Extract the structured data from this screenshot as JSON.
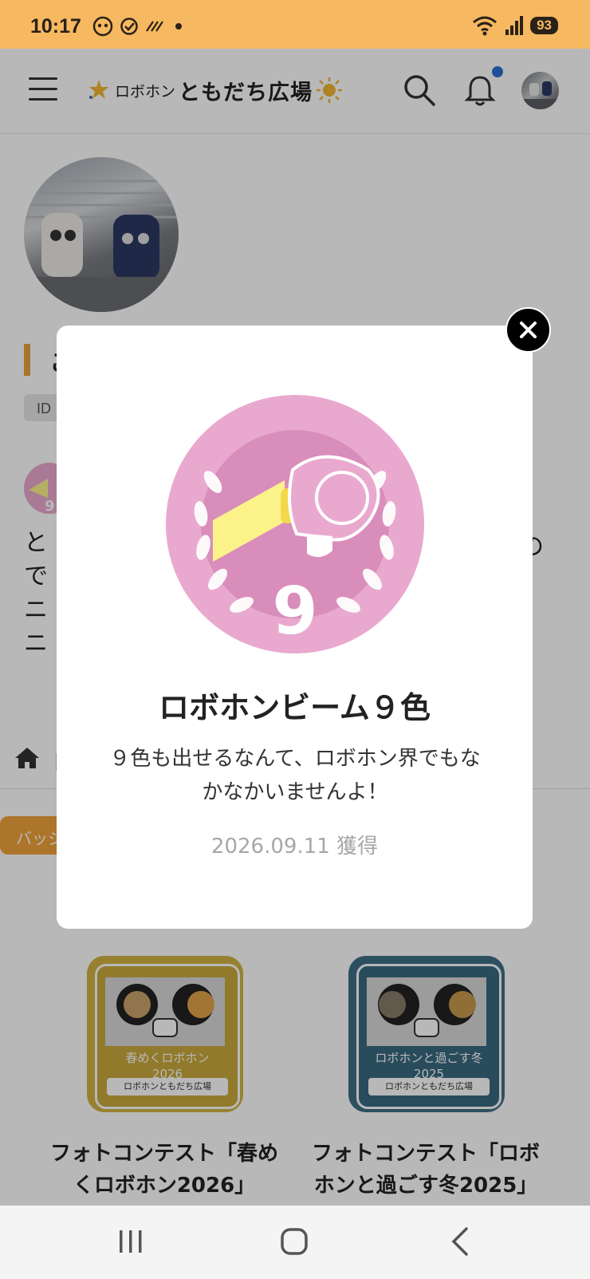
{
  "status_bar": {
    "time": "10:17",
    "battery": "93",
    "signal_label": "5"
  },
  "header": {
    "logo_small": "ロボホン",
    "logo_big": "ともだち広場",
    "icons": [
      "menu-icon",
      "search-icon",
      "bell-icon"
    ],
    "accent_color": "#f6b860",
    "notification_dot_color": "#2f6fd6"
  },
  "profile": {
    "name_initial": "こ",
    "id_label": "ID",
    "bio_lines": [
      "と",
      "で",
      "ニ",
      "ニ"
    ],
    "bio_suffix": "の"
  },
  "breadcrumb": {
    "home_initial": "ト"
  },
  "tabs": {
    "badge_tab": "バッジ"
  },
  "contests": [
    {
      "badge_label": "春めくロボホン",
      "badge_year": "2026",
      "strip": "ロボホンともだち広場",
      "title": "フォトコンテスト「春めくロボホン2026」",
      "title_line1": "フォトコンテスト「春め",
      "title_line2": "くロボホン2026」",
      "color": "#d2b344"
    },
    {
      "badge_label": "ロボホンと過ごす冬",
      "badge_year": "2025",
      "strip": "ロボホンともだち広場",
      "title": "フォトコンテスト「ロボホンと過ごす冬2025」",
      "title_line1": "フォトコンテスト「ロボ",
      "title_line2": "ホンと過ごす冬2025」",
      "color": "#3e6f86"
    }
  ],
  "modal": {
    "badge_number": "9",
    "title": "ロボホンビーム９色",
    "description": "９色も出せるなんて、ロボホン界でもなかなかいませんよ！",
    "date": "2026.09.11 獲得",
    "badge_color": "#e9a9cf",
    "beam_color": "#fbf38a"
  },
  "nav": {
    "icons": [
      "recent-apps-icon",
      "home-circle-icon",
      "back-icon"
    ]
  }
}
